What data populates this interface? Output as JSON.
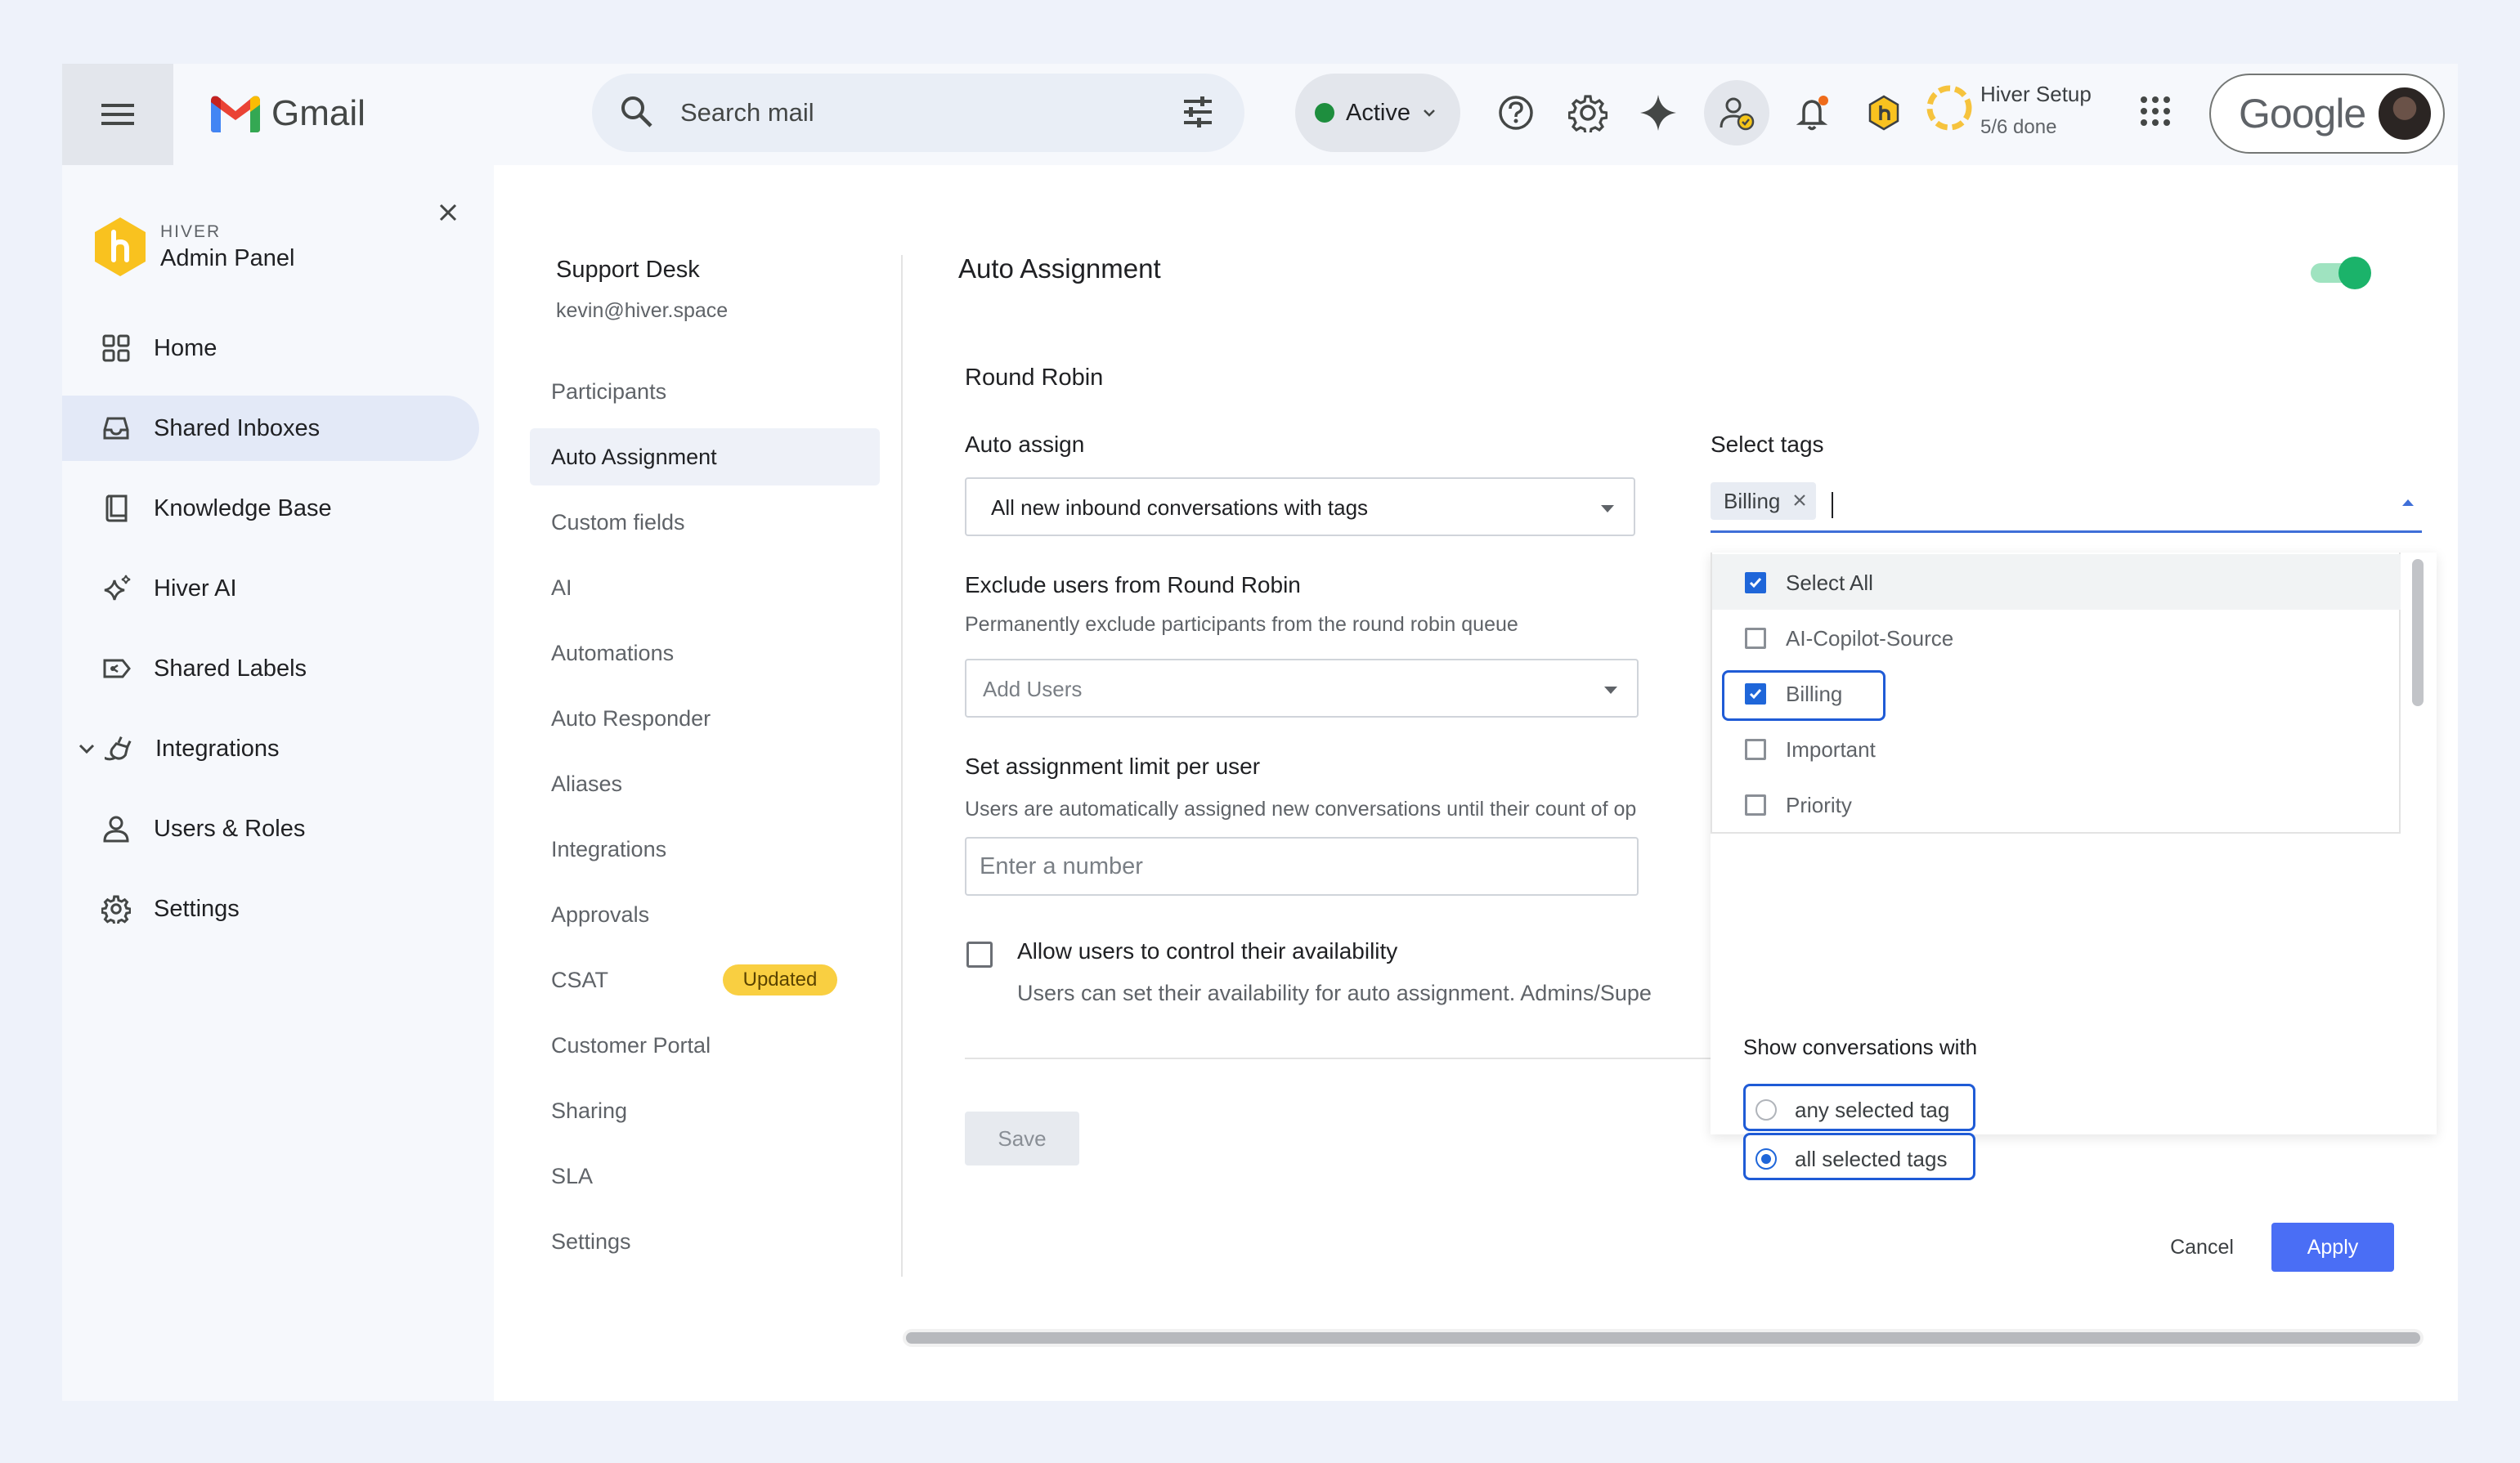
{
  "gmail": {
    "app_name": "Gmail",
    "search_placeholder": "Search mail",
    "status": "Active",
    "setup_title": "Hiver Setup",
    "setup_progress": "5/6 done",
    "account_brand": "Google"
  },
  "sidebar": {
    "brand": "HIVER",
    "title": "Admin Panel",
    "items": [
      {
        "label": "Home",
        "icon": "grid-icon"
      },
      {
        "label": "Shared Inboxes",
        "icon": "inbox-icon"
      },
      {
        "label": "Knowledge Base",
        "icon": "book-icon"
      },
      {
        "label": "Hiver AI",
        "icon": "sparkle-icon"
      },
      {
        "label": "Shared Labels",
        "icon": "label-icon"
      },
      {
        "label": "Integrations",
        "icon": "plug-icon"
      },
      {
        "label": "Users & Roles",
        "icon": "user-icon"
      },
      {
        "label": "Settings",
        "icon": "gear-icon"
      }
    ],
    "selected": "Shared Inboxes"
  },
  "subnav": {
    "title": "Support Desk",
    "email": "kevin@hiver.space",
    "items": [
      "Participants",
      "Auto Assignment",
      "Custom fields",
      "AI",
      "Automations",
      "Auto Responder",
      "Aliases",
      "Integrations",
      "Approvals",
      "CSAT",
      "Customer Portal",
      "Sharing",
      "SLA",
      "Settings"
    ],
    "selected": "Auto Assignment",
    "badge": "Updated"
  },
  "panel": {
    "title": "Auto Assignment",
    "enabled": true,
    "section": "Round Robin",
    "auto_assign_label": "Auto assign",
    "auto_assign_value": "All new inbound conversations with tags",
    "exclude_label": "Exclude users from Round Robin",
    "exclude_help": "Permanently exclude participants from the round robin queue",
    "exclude_placeholder": "Add Users",
    "limit_label": "Set assignment limit per user",
    "limit_help": "Users are automatically assigned new conversations until their count of op",
    "limit_placeholder": "Enter a number",
    "availability_label": "Allow users to control their availability",
    "availability_help": "Users can set their availability for auto assignment. Admins/Supe",
    "save_label": "Save"
  },
  "tags": {
    "label": "Select tags",
    "selected_chip": "Billing",
    "options": [
      {
        "label": "Select All",
        "checked": true
      },
      {
        "label": "AI-Copilot-Source",
        "checked": false
      },
      {
        "label": "Billing",
        "checked": true
      },
      {
        "label": "Important",
        "checked": false
      },
      {
        "label": "Priority",
        "checked": false
      }
    ],
    "show_label": "Show conversations with",
    "radio_options": [
      "any selected tag",
      "all selected tags"
    ],
    "radio_selected": "all selected tags",
    "cancel_label": "Cancel",
    "apply_label": "Apply"
  },
  "colors": {
    "accent": "#1f66d9",
    "toggle": "#1bb36a",
    "apply": "#4a6ef5",
    "badge": "#f9cf41"
  }
}
